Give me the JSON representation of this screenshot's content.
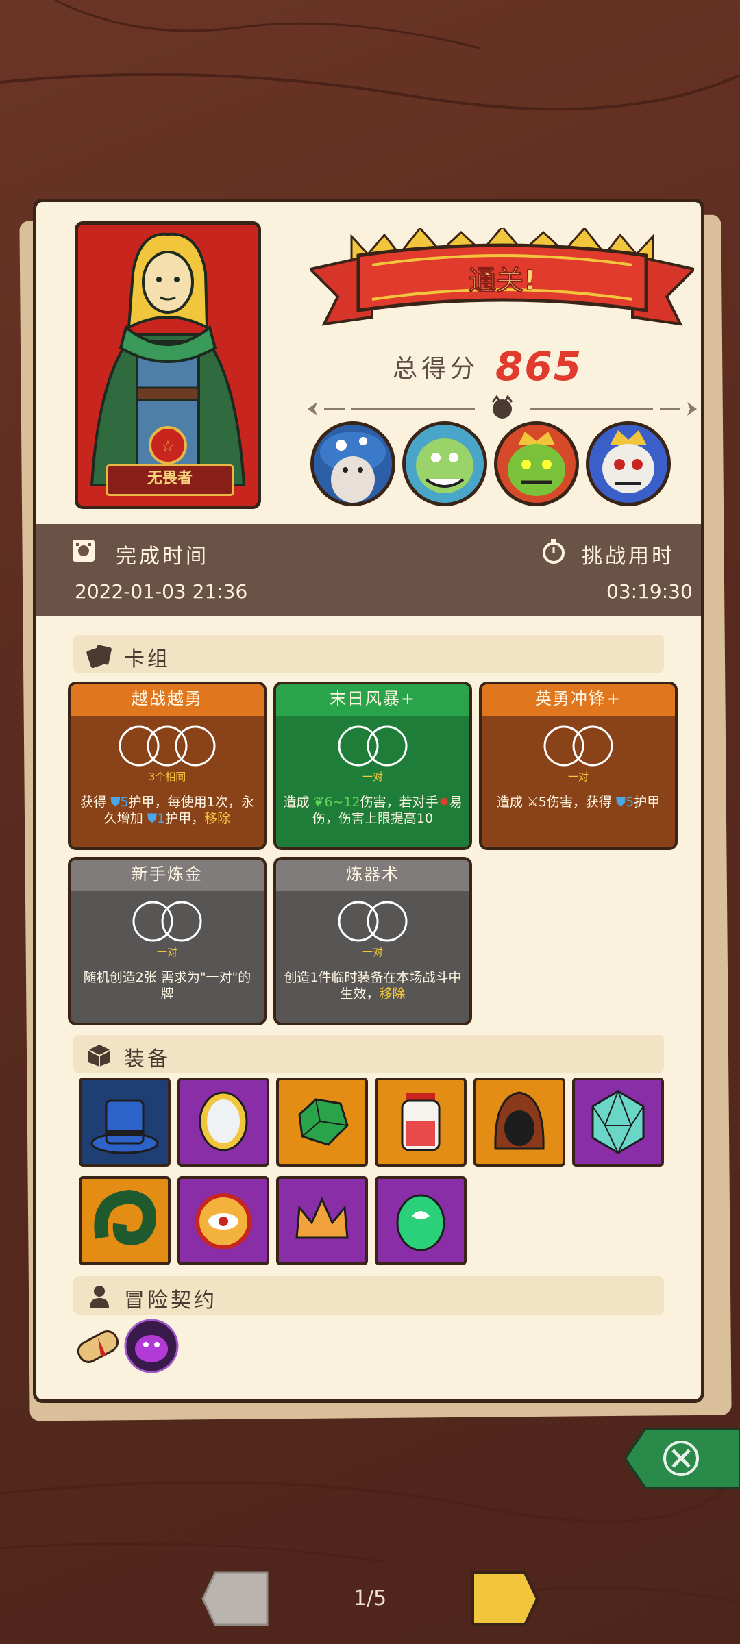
{
  "hero": {
    "name": "无畏者"
  },
  "result": {
    "banner": "通关!",
    "score_label": "总得分",
    "score": "865"
  },
  "bosses": [
    "mushroom-wizard-boss",
    "green-lizard-boss",
    "green-king-boss",
    "skeleton-beast-boss"
  ],
  "info": {
    "complete_time_label": "完成时间",
    "complete_time": "2022-01-03 21:36",
    "challenge_time_label": "挑战用时",
    "challenge_time": "03:19:30"
  },
  "deck": {
    "title": "卡组",
    "cards": [
      {
        "name": "越战越勇",
        "req": "3个相同",
        "desc_a": "获得 ",
        "num_a": "5",
        "desc_b": "护甲，每使用1次，永久增加 ",
        "num_b": "1",
        "desc_c": "护甲，",
        "tag": "移除"
      },
      {
        "name": "末日风暴+",
        "req": "一对",
        "desc_a": "造成 ",
        "num_a": "6~12",
        "desc_b": "伤害，若对手",
        "desc_c": "易伤，伤害上限提高10"
      },
      {
        "name": "英勇冲锋+",
        "req": "一对",
        "desc_a": "造成 ",
        "num_a": "5",
        "desc_b": "伤害，获得 ",
        "num_b": "5",
        "desc_c": "护甲"
      },
      {
        "name": "新手炼金",
        "req": "一对",
        "desc": "随机创造2张 需求为\"一对\"的牌"
      },
      {
        "name": "炼器术",
        "req": "一对",
        "desc": "创造1件临时装备在本场战斗中生效，",
        "tag": "移除"
      }
    ]
  },
  "equipment": {
    "title": "装备",
    "items": [
      "top-hat-icon",
      "magic-mirror-icon",
      "green-gem-icon",
      "potion-jar-icon",
      "hood-icon",
      "d20-dice-icon",
      "horn-icon",
      "fire-eye-icon",
      "crown-icon",
      "leaf-egg-icon"
    ]
  },
  "contract": {
    "title": "冒险契约",
    "items": [
      "scroll-icon",
      "purple-monster-icon"
    ]
  },
  "nav": {
    "page": "1/5"
  },
  "colors": {
    "accent_red": "#e13b2d",
    "paper": "#fbf2de",
    "band": "#6b5246"
  }
}
